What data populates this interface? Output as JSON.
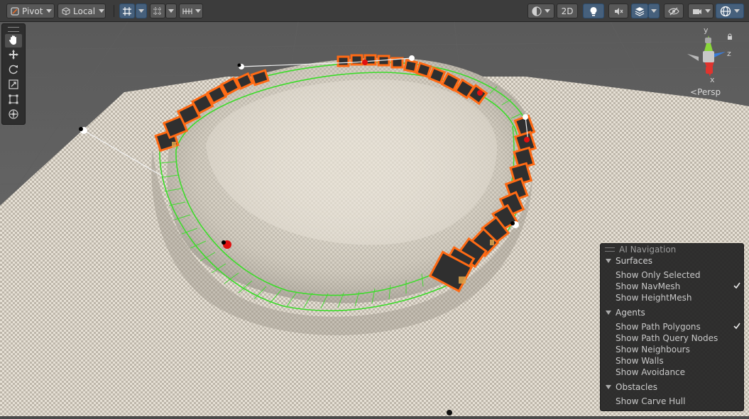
{
  "toolbar": {
    "pivot_label": "Pivot",
    "local_label": "Local",
    "mode_2d_label": "2D"
  },
  "tools": [
    "hand",
    "move",
    "rotate",
    "scale",
    "rect",
    "transform"
  ],
  "gizmo": {
    "y_label": "y",
    "z_label": "z",
    "x_label": "x",
    "projection_label": "Persp",
    "colors": {
      "x": "#e0342e",
      "y": "#8ad73a",
      "z": "#3a7bd8"
    }
  },
  "ai_navigation": {
    "title": "AI Navigation",
    "surfaces": {
      "title": "Surfaces",
      "items": [
        {
          "label": "Show Only Selected",
          "checked": false
        },
        {
          "label": "Show NavMesh",
          "checked": true
        },
        {
          "label": "Show HeightMesh",
          "checked": false
        }
      ]
    },
    "agents": {
      "title": "Agents",
      "items": [
        {
          "label": "Show Path Polygons",
          "checked": true
        },
        {
          "label": "Show Path Query Nodes",
          "checked": false
        },
        {
          "label": "Show Neighbours",
          "checked": false
        },
        {
          "label": "Show Walls",
          "checked": false
        },
        {
          "label": "Show Avoidance",
          "checked": false
        }
      ]
    },
    "obstacles": {
      "title": "Obstacles",
      "items": [
        {
          "label": "Show Carve Hull",
          "checked": false
        }
      ]
    }
  },
  "colors": {
    "navmesh": "#3cdc2a",
    "selection_outline": "#ff6a14",
    "floor_light": "#e3ddd2",
    "floor_dark": "#b9b2a6",
    "toolbar_bg": "#3c3c3c",
    "active_button": "#46607c"
  }
}
